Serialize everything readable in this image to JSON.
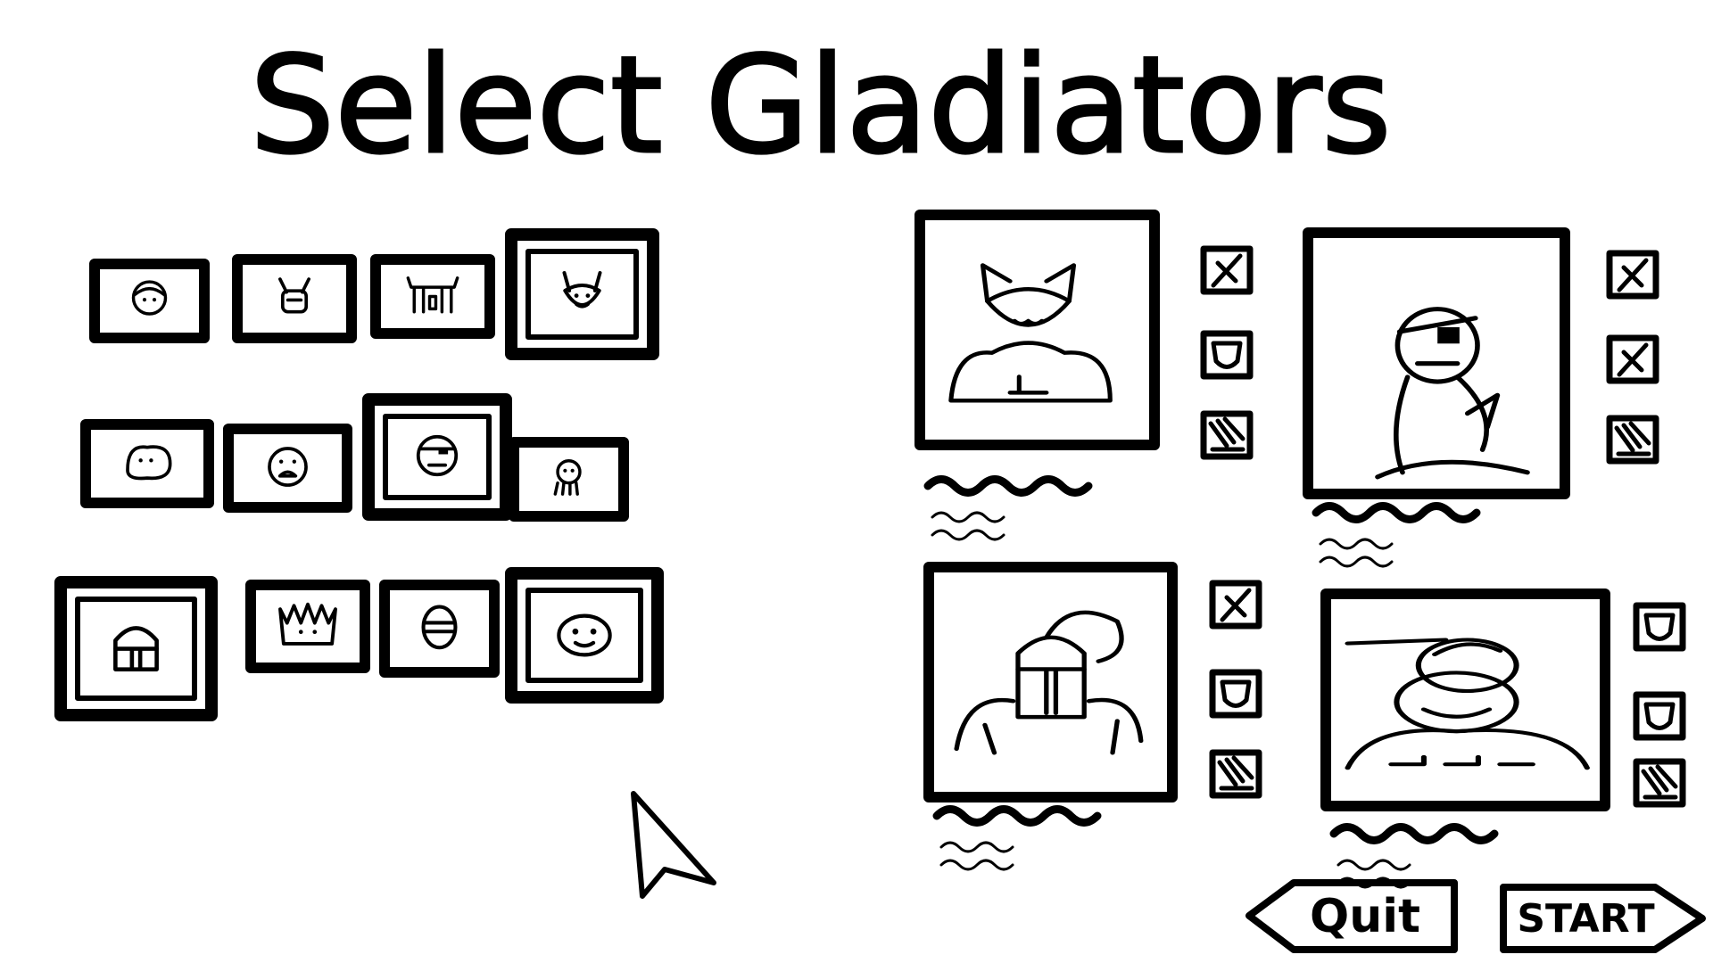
{
  "screen": {
    "title": "Select Gladiators"
  },
  "roster": {
    "items": [
      {
        "icon": "helmet-face-icon",
        "selected": false
      },
      {
        "icon": "horned-beast-icon",
        "selected": false
      },
      {
        "icon": "quadruped-creature-icon",
        "selected": false
      },
      {
        "icon": "cat-face-icon",
        "selected": true
      },
      {
        "icon": "blob-creature-icon",
        "selected": false
      },
      {
        "icon": "screaming-face-icon",
        "selected": false
      },
      {
        "icon": "eyepatch-face-icon",
        "selected": true
      },
      {
        "icon": "octopus-icon",
        "selected": false
      },
      {
        "icon": "knight-helmet-icon",
        "selected": true
      },
      {
        "icon": "spiky-monster-icon",
        "selected": false
      },
      {
        "icon": "bandaged-face-icon",
        "selected": false
      },
      {
        "icon": "round-creature-icon",
        "selected": true
      }
    ]
  },
  "team": {
    "slots": [
      {
        "portrait": "cat-gladiator-portrait",
        "stats": [
          "sword-stat-icon",
          "shield-stat-icon",
          "claw-stat-icon"
        ]
      },
      {
        "portrait": "pirate-gladiator-portrait",
        "stats": [
          "sword-stat-icon",
          "sword-stat-icon",
          "claw-stat-icon"
        ]
      },
      {
        "portrait": "knight-gladiator-portrait",
        "stats": [
          "sword-stat-icon",
          "shield-stat-icon",
          "claw-stat-icon"
        ]
      },
      {
        "portrait": "blob-gladiator-portrait",
        "stats": [
          "shield-stat-icon",
          "shield-stat-icon",
          "claw-stat-icon"
        ]
      }
    ]
  },
  "buttons": {
    "quit_label": "Quit",
    "start_label": "START"
  }
}
